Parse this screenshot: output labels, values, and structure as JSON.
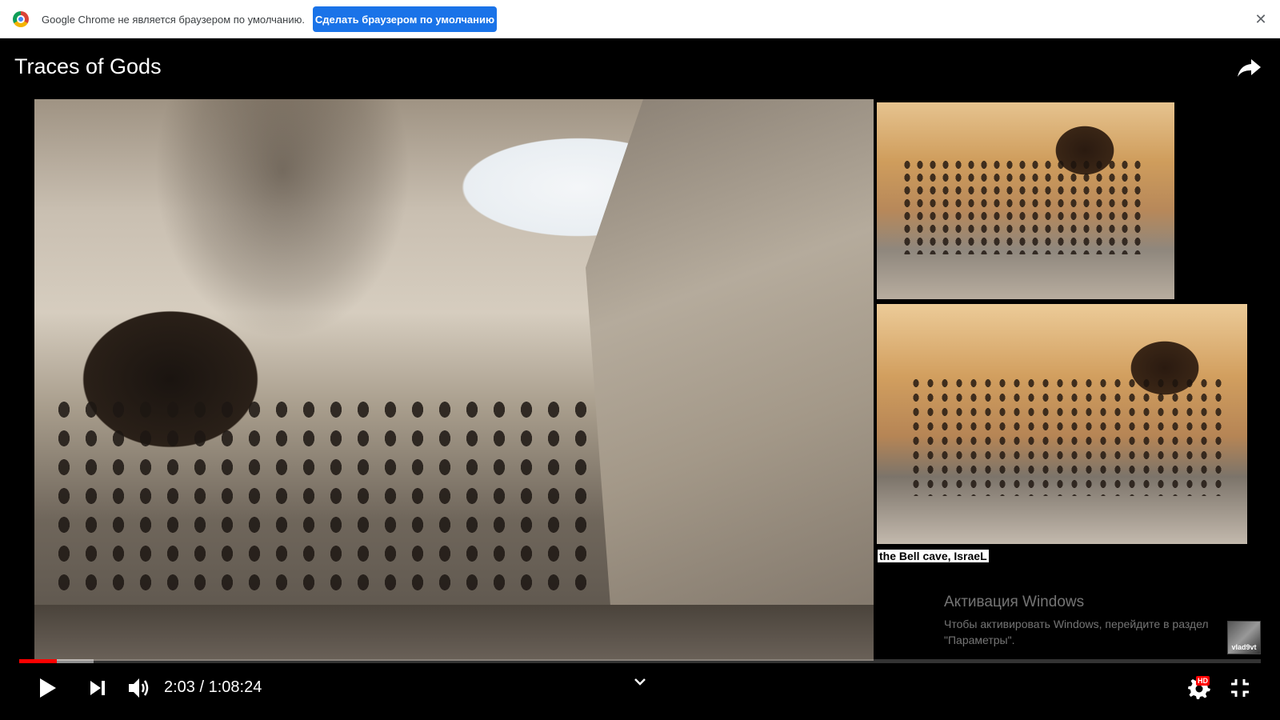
{
  "infobar": {
    "message": "Google Chrome не является браузером по умолчанию.",
    "button_label": "Сделать браузером по умолчанию",
    "close_glyph": "✕"
  },
  "player": {
    "title": "Traces of Gods",
    "caption": "the Bell cave, IsraeL",
    "channel": "vlad9vt",
    "time_current": "2:03",
    "time_total": "1:08:24",
    "time_display": "2:03 / 1:08:24",
    "progress_played": 0.03,
    "progress_buffered": 0.06,
    "hd_badge": "HD",
    "accent_color": "#ff0000"
  },
  "watermark": {
    "title": "Активация Windows",
    "text_line1": "Чтобы активировать Windows, перейдите в раздел",
    "text_line2": "\"Параметры\"."
  },
  "icons": [
    "chrome-icon",
    "close-icon",
    "share-icon",
    "play-icon",
    "next-icon",
    "volume-icon",
    "chevron-down-icon",
    "settings-icon",
    "exit-fullscreen-icon"
  ]
}
